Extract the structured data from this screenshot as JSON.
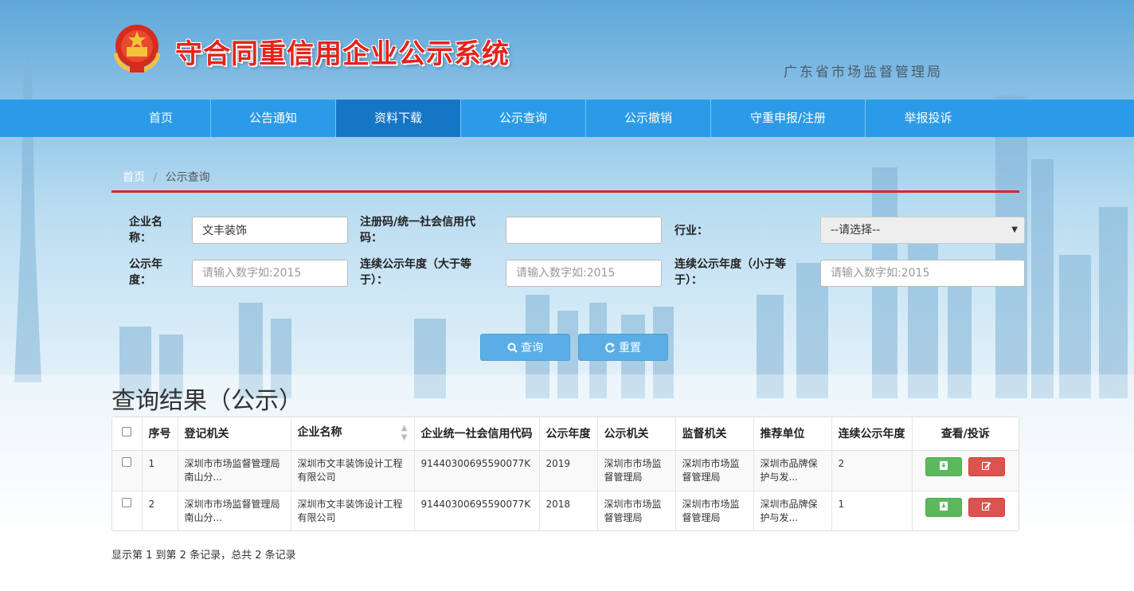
{
  "header": {
    "title": "守合同重信用企业公示系统",
    "subtitle": "广东省市场监督管理局",
    "emblem_icon": "national-emblem-icon"
  },
  "nav": {
    "items": [
      "首页",
      "公告通知",
      "资料下载",
      "公示查询",
      "公示撤销",
      "守重申报/注册",
      "举报投诉"
    ],
    "active": "资料下载"
  },
  "breadcrumb": {
    "home": "首页",
    "separator": "/",
    "current": "公示查询"
  },
  "form": {
    "company_name": {
      "label": "企业名称：",
      "value": "文丰装饰"
    },
    "reg_code": {
      "label": "注册码/统一社会信用代码：",
      "value": ""
    },
    "industry": {
      "label": "行业：",
      "selected": "--请选择--"
    },
    "year": {
      "label": "公示年度：",
      "placeholder": "请输入数字如:2015"
    },
    "cont_year_gte": {
      "label": "连续公示年度（大于等于）：",
      "placeholder": "请输入数字如:2015"
    },
    "cont_year_lte": {
      "label": "连续公示年度（小于等于）：",
      "placeholder": "请输入数字如:2015"
    }
  },
  "buttons": {
    "query": "查询",
    "reset": "重置"
  },
  "results": {
    "title": "查询结果（公示）",
    "columns": [
      "序号",
      "登记机关",
      "企业名称",
      "企业统一社会信用代码",
      "公示年度",
      "公示机关",
      "监督机关",
      "推荐单位",
      "连续公示年度",
      "查看/投诉"
    ],
    "rows": [
      {
        "no": "1",
        "reg_org": "深圳市市场监督管理局南山分...",
        "company": "深圳市文丰装饰设计工程有限公司",
        "code": "91440300695590077K",
        "year": "2019",
        "pub_org": "深圳市市场监督管理局",
        "sup_org": "深圳市市场监督管理局",
        "rec_org": "深圳市品牌保护与发...",
        "cont_year": "2"
      },
      {
        "no": "2",
        "reg_org": "深圳市市场监督管理局南山分...",
        "company": "深圳市文丰装饰设计工程有限公司",
        "code": "91440300695590077K",
        "year": "2018",
        "pub_org": "深圳市市场监督管理局",
        "sup_org": "深圳市市场监督管理局",
        "rec_org": "深圳市品牌保护与发...",
        "cont_year": "1"
      }
    ],
    "summary": "显示第 1 到第 2 条记录，总共 2 条记录"
  },
  "colors": {
    "nav_bg": "#2b9be8",
    "nav_active": "#1676c6",
    "title_red": "#e5231b",
    "divider_red": "#d22a2a",
    "btn_blue": "#5aaee5",
    "btn_green": "#5cb85c",
    "btn_red": "#d9534f"
  }
}
